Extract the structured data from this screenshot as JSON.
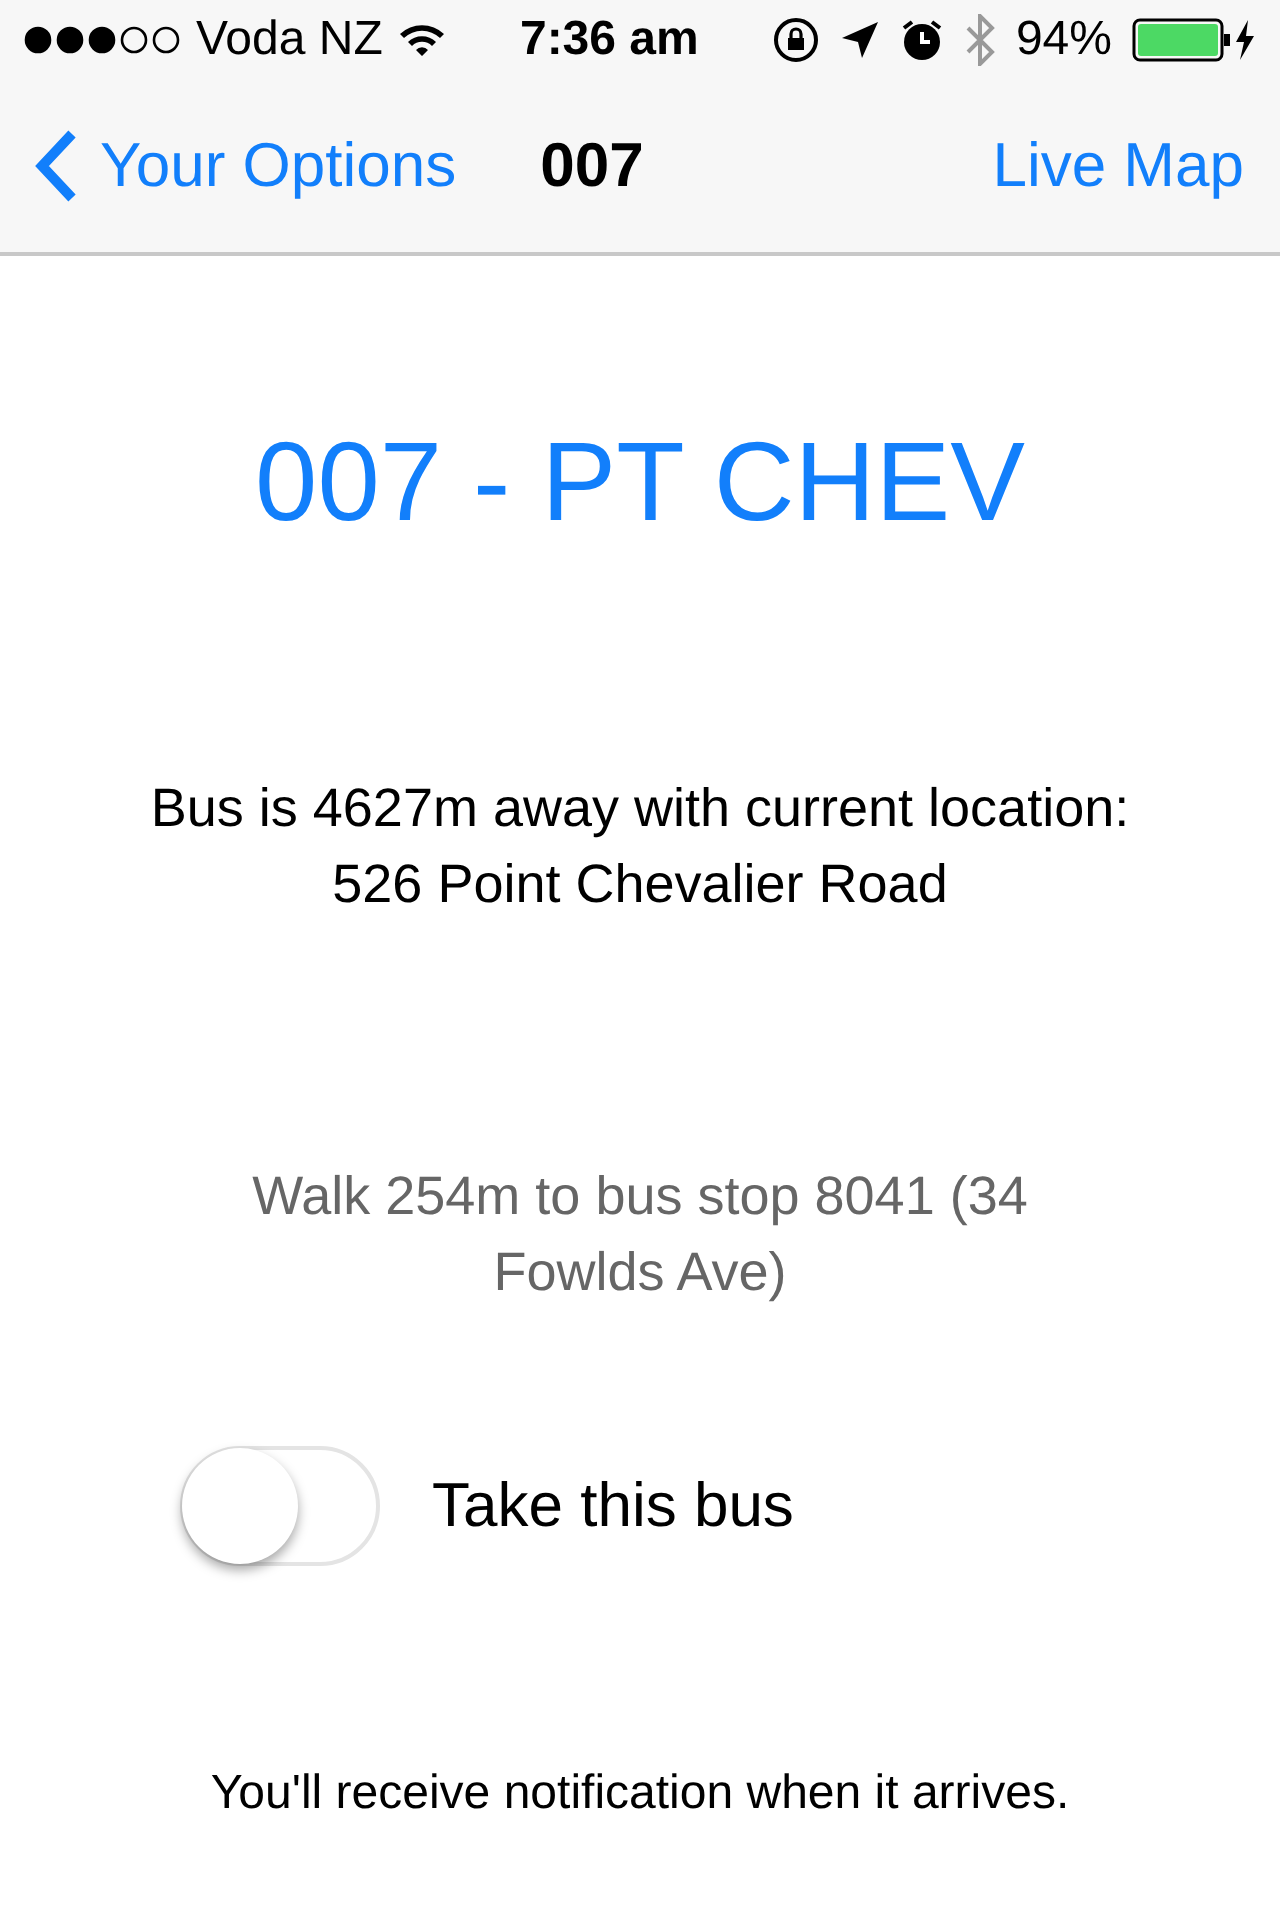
{
  "status_bar": {
    "carrier": "Voda NZ",
    "time": "7:36 am",
    "battery": "94%"
  },
  "nav_bar": {
    "back": "Your Options",
    "title": "007",
    "action": "Live Map"
  },
  "route_title": "007 - PT CHEV",
  "bus_info": "Bus is 4627m away with current location: 526 Point Chevalier Road",
  "walk_info": "Walk 254m to bus stop 8041 (34 Fowlds Ave)",
  "toggle": {
    "label": "Take this bus",
    "on": false
  },
  "note": "You'll receive notification when it arrives."
}
